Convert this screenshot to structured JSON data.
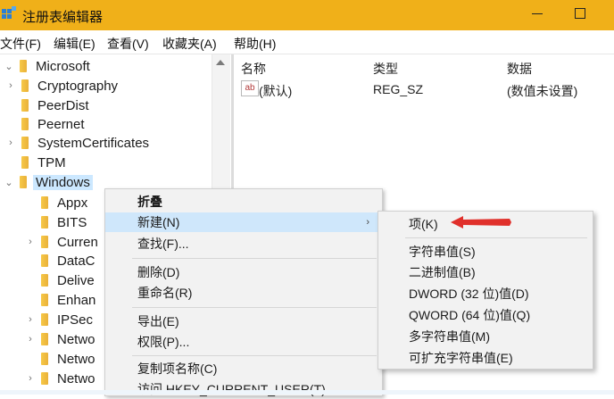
{
  "window": {
    "title": "注册表编辑器",
    "controls": [
      "minimize",
      "maximize"
    ]
  },
  "menubar": [
    "文件(F)",
    "编辑(E)",
    "查看(V)",
    "收藏夹(A)",
    "帮助(H)"
  ],
  "tree": [
    {
      "label": "Microsoft",
      "caret": "⌄"
    },
    {
      "label": "Cryptography",
      "caret": "›"
    },
    {
      "label": "PeerDist",
      "caret": ""
    },
    {
      "label": "Peernet",
      "caret": ""
    },
    {
      "label": "SystemCertificates",
      "caret": "›"
    },
    {
      "label": "TPM",
      "caret": ""
    },
    {
      "label": "Windows",
      "caret": "⌄",
      "selected": true
    },
    {
      "label": "Appx",
      "caret": ""
    },
    {
      "label": "BITS",
      "caret": ""
    },
    {
      "label": "Curren",
      "caret": "›"
    },
    {
      "label": "DataC",
      "caret": ""
    },
    {
      "label": "Delive",
      "caret": ""
    },
    {
      "label": "Enhan",
      "caret": ""
    },
    {
      "label": "IPSec",
      "caret": "›"
    },
    {
      "label": "Netwo",
      "caret": "›"
    },
    {
      "label": "Netwo",
      "caret": ""
    },
    {
      "label": "Netwo",
      "caret": "›"
    }
  ],
  "list": {
    "columns": [
      "名称",
      "类型",
      "数据"
    ],
    "rows": [
      {
        "icon": "ab",
        "name": "(默认)",
        "type": "REG_SZ",
        "data": "(数值未设置)"
      }
    ]
  },
  "context_menu": {
    "items": [
      "折叠",
      "新建(N)",
      "查找(F)...",
      "删除(D)",
      "重命名(R)",
      "导出(E)",
      "权限(P)...",
      "复制项名称(C)",
      "访问 HKEY_CURRENT_USER(T)"
    ],
    "highlighted": "新建(N)",
    "submenu_arrow": "›"
  },
  "submenu": {
    "items": [
      "项(K)",
      "字符串值(S)",
      "二进制值(B)",
      "DWORD (32 位)值(D)",
      "QWORD (64 位)值(Q)",
      "多字符串值(M)",
      "可扩充字符串值(E)"
    ]
  },
  "colors": {
    "titlebar": "#f0b019",
    "highlight": "#cfe7fb",
    "annotation_arrow": "#e0302b"
  }
}
